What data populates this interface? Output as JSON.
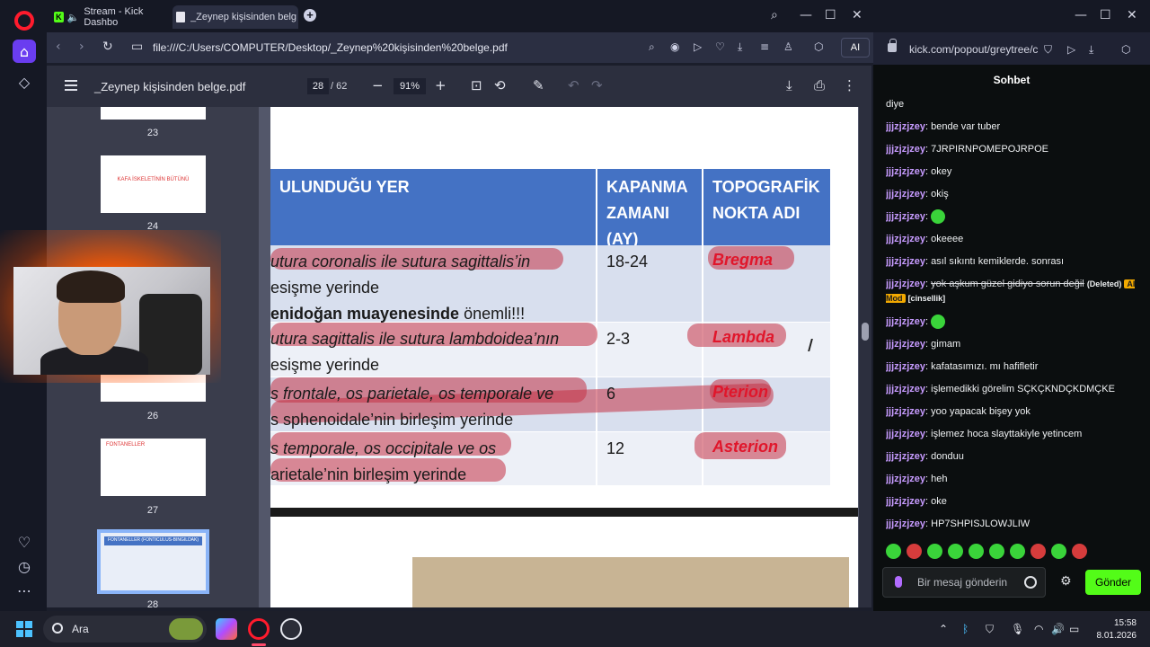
{
  "browser": {
    "tabs": [
      {
        "label": "Stream - Kick Dashbo"
      },
      {
        "label": "_Zeynep kişisinden belge."
      }
    ],
    "url": "file:///C:/Users/COMPUTER/Desktop/_Zeynep%20kişisinden%20belge.pdf",
    "ai_label": "AI"
  },
  "pdf": {
    "title": "_Zeynep kişisinden belge.pdf",
    "current_page": "28",
    "total_pages": "/ 62",
    "zoom": "91%",
    "thumbnails": [
      {
        "num": "23"
      },
      {
        "num": "24",
        "text": "KAFA İSKELETİNİN BÜTÜNÜ"
      },
      {
        "num": "26"
      },
      {
        "num": "27",
        "text": "FONTANELLER"
      },
      {
        "num": "28",
        "text": "FONTANELLER (FONTICULUS-BINGILDAK)"
      }
    ],
    "table": {
      "headers": [
        "ULUNDUĞU YER",
        "KAPANMA ZAMANI (AY)",
        "TOPOGRAFİK NOKTA ADI"
      ],
      "rows": [
        {
          "location_line1": "utura coronalis ile sutura sagittalis’in",
          "location_line2": "esişme yerinde",
          "location_line3a": "enidoğan muayenesinde",
          "location_line3b": " önemli!!!",
          "time": "18-24",
          "name": "Bregma"
        },
        {
          "location_line1": "utura sagittalis ile sutura lambdoidea’nın",
          "location_line2": "esişme yerinde",
          "time": "2-3",
          "name": "Lambda"
        },
        {
          "location_line1": "s frontale, os parietale, os temporale ve",
          "location_line2": "s sphenoidale’nin birleşim yerinde",
          "time": "6",
          "name": "Pterion"
        },
        {
          "location_line1": "s temporale, os occipitale ve os",
          "location_line2": "arietale’nin birleşim yerinde",
          "time": "12",
          "name": "Asterion"
        }
      ]
    }
  },
  "chat": {
    "url": "kick.com/popout/greytree/c",
    "header": "Sohbet",
    "first_line": "diye",
    "messages": [
      {
        "user": "jjjzjzjzey",
        "text": "bende var tuber"
      },
      {
        "user": "jjjzjzjzey",
        "text": "7JRPIRNPOMEPOJRPOE"
      },
      {
        "user": "jjjzjzjzey",
        "text": "okey"
      },
      {
        "user": "jjjzjzjzey",
        "text": "okiş"
      },
      {
        "user": "jjjzjzjzey",
        "text": "",
        "emote": true
      },
      {
        "user": "jjjzjzjzey",
        "text": "okeeee"
      },
      {
        "user": "jjjzjzjzey",
        "text": "asıl sıkıntı kemiklerde. sonrası"
      }
    ],
    "deleted_message": {
      "user": "jjjzjzjzey",
      "text": "yok aşkum güzel gidiyo sorun değil",
      "deleted_tag": "(Deleted)",
      "mod_badge": "AI Mod",
      "reason": "[cinsellik]"
    },
    "messages2": [
      {
        "user": "jjjzjzjzey",
        "text": "",
        "emote": true
      },
      {
        "user": "jjjzjzjzey",
        "text": "gimam"
      },
      {
        "user": "jjjzjzjzey",
        "text": "kafatasımızı. mı hafifletir"
      },
      {
        "user": "jjjzjzjzey",
        "text": "işlemedikki görelim SÇKÇKNDÇKDMÇKE"
      },
      {
        "user": "jjjzjzjzey",
        "text": "yoo yapacak bişey yok"
      },
      {
        "user": "jjjzjzjzey",
        "text": "işlemez hoca slayttakiyle yetincem"
      },
      {
        "user": "jjjzjzjzey",
        "text": "donduu"
      },
      {
        "user": "jjjzjzjzey",
        "text": "heh"
      },
      {
        "user": "jjjzjzjzey",
        "text": "oke"
      },
      {
        "user": "jjjzjzjzey",
        "text": "HP7SHPISJLOWJLIW"
      }
    ],
    "input_placeholder": "Bir mesaj gönderin",
    "send_label": "Gönder"
  },
  "taskbar": {
    "search_label": "Ara",
    "time": "15:58",
    "date": "8.01.2026"
  },
  "colors": {
    "kick_green": "#53fc18",
    "table_header": "#4472c4",
    "highlight": "#c43246",
    "label_red": "#e0162b",
    "chat_user": "#c79bff"
  }
}
